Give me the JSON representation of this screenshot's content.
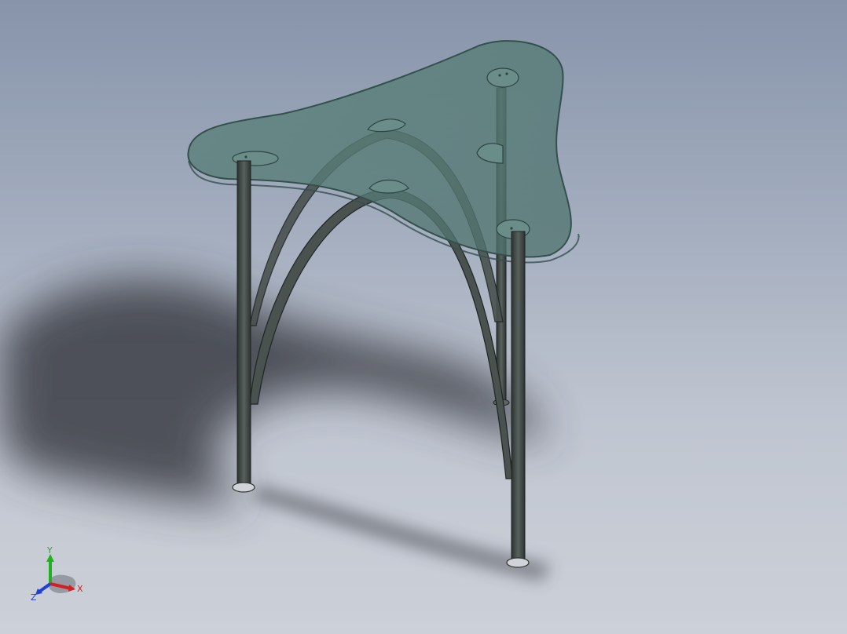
{
  "viewport": {
    "background_top": "#8794aa",
    "background_bottom": "#ccd0d8",
    "model_name": "glass-top-tripod-table"
  },
  "colors": {
    "glass": "#5f8680",
    "glass_edge": "#3f5a57",
    "metal": "#4a524f",
    "metal_dark": "#2c3230",
    "shadow": "#3a3d44"
  },
  "triad": {
    "x_label": "X",
    "y_label": "Y",
    "z_label": "Z",
    "x_color": "#d42020",
    "y_color": "#1fb21f",
    "z_color": "#1f3fd8"
  }
}
